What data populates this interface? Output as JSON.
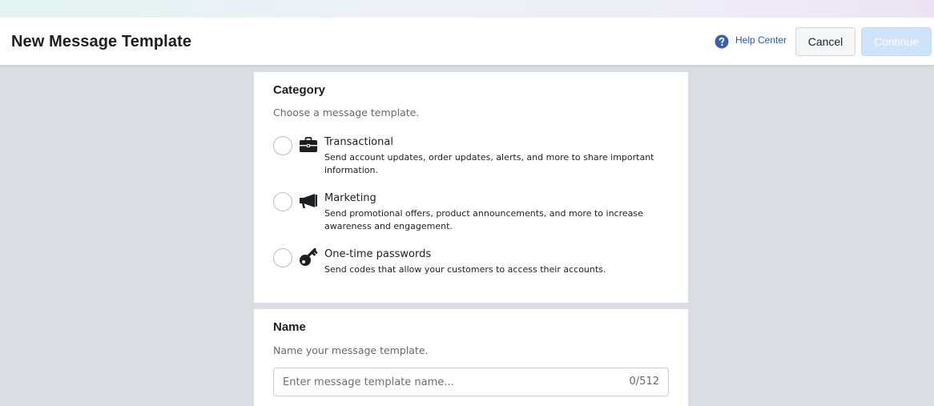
{
  "header": {
    "title": "New Message Template",
    "help_label": "Help Center",
    "help_icon": "question-circle-icon",
    "cancel_label": "Cancel",
    "continue_label": "Continue"
  },
  "category": {
    "title": "Category",
    "subtitle": "Choose a message template.",
    "options": [
      {
        "label": "Transactional",
        "description": "Send account updates, order updates, alerts, and more to share important information.",
        "icon": "briefcase-icon",
        "selected": false
      },
      {
        "label": "Marketing",
        "description": "Send promotional offers, product announcements, and more to increase awareness and engagement.",
        "icon": "megaphone-icon",
        "selected": false
      },
      {
        "label": "One-time passwords",
        "description": "Send codes that allow your customers to access their accounts.",
        "icon": "key-icon",
        "selected": false
      }
    ]
  },
  "name": {
    "title": "Name",
    "subtitle": "Name your message template.",
    "placeholder": "Enter message template name...",
    "value": "",
    "char_count": "0/512"
  },
  "colors": {
    "accent": "#1f5cb8",
    "continue_disabled": "#cfe3fa",
    "background": "#dadde1"
  }
}
